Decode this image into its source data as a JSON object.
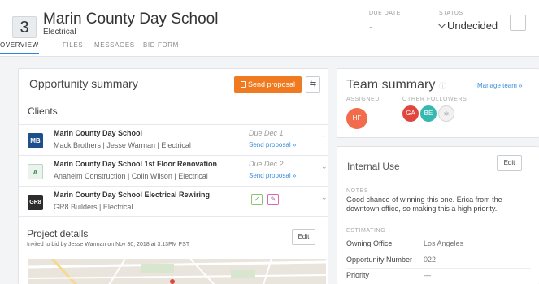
{
  "header": {
    "number": "3",
    "title": "Marin County Day School",
    "subtitle": "Electrical",
    "due_date_label": "DUE DATE",
    "due_date_value": "-",
    "status_label": "STATUS",
    "status_value": "Undecided"
  },
  "tabs": [
    {
      "label": "OVERVIEW",
      "active": true
    },
    {
      "label": "FILES",
      "active": false
    },
    {
      "label": "MESSAGES",
      "active": false
    },
    {
      "label": "BID FORM",
      "active": false
    }
  ],
  "opportunity": {
    "title": "Opportunity summary",
    "send_label": "Send proposal",
    "clients_heading": "Clients",
    "clients": [
      {
        "logo": "MB",
        "name": "Marin County Day School",
        "meta": "Mack Brothers  |  Jesse Warman  |  Electrical",
        "due": "Due Dec 1",
        "link": "Send proposal »"
      },
      {
        "logo": "A",
        "name": "Marin County Day School 1st Floor Renovation",
        "meta": "Anaheim Construction  |  Colin Wilson  |  Electrical",
        "due": "Due Dec 2",
        "link": "Send proposal »"
      },
      {
        "logo": "GR8",
        "name": "Marin County Day School Electrical Rewiring",
        "meta": "GR8 Builders  |  Electrical",
        "due": "",
        "link": ""
      }
    ]
  },
  "project": {
    "title": "Project details",
    "subtitle": "Invited to bid by Jesse Warman on Nov 30, 2018 at 3:13PM PST",
    "edit_label": "Edit"
  },
  "team": {
    "title": "Team summary",
    "manage_label": "Manage team »",
    "assigned_label": "ASSIGNED",
    "followers_label": "OTHER FOLLOWERS",
    "assigned": [
      {
        "initials": "HF",
        "color": "#f26b4a"
      }
    ],
    "followers": [
      {
        "initials": "GA",
        "color": "#e0463e"
      },
      {
        "initials": "BE",
        "color": "#35b8b0"
      }
    ]
  },
  "internal": {
    "title": "Internal Use",
    "edit_label": "Edit",
    "notes_label": "NOTES",
    "notes": "Good chance of winning this one. Erica from the downtown office, so making this a high priority.",
    "estimating_label": "ESTIMATING",
    "rows": [
      {
        "label": "Owning Office",
        "value": "Los Angeles"
      },
      {
        "label": "Opportunity Number",
        "value": "022"
      },
      {
        "label": "Priority",
        "value": "—"
      }
    ]
  },
  "colors": {
    "accent": "#2b86d9",
    "orange": "#f07a1f",
    "link": "#3b8fd9"
  }
}
